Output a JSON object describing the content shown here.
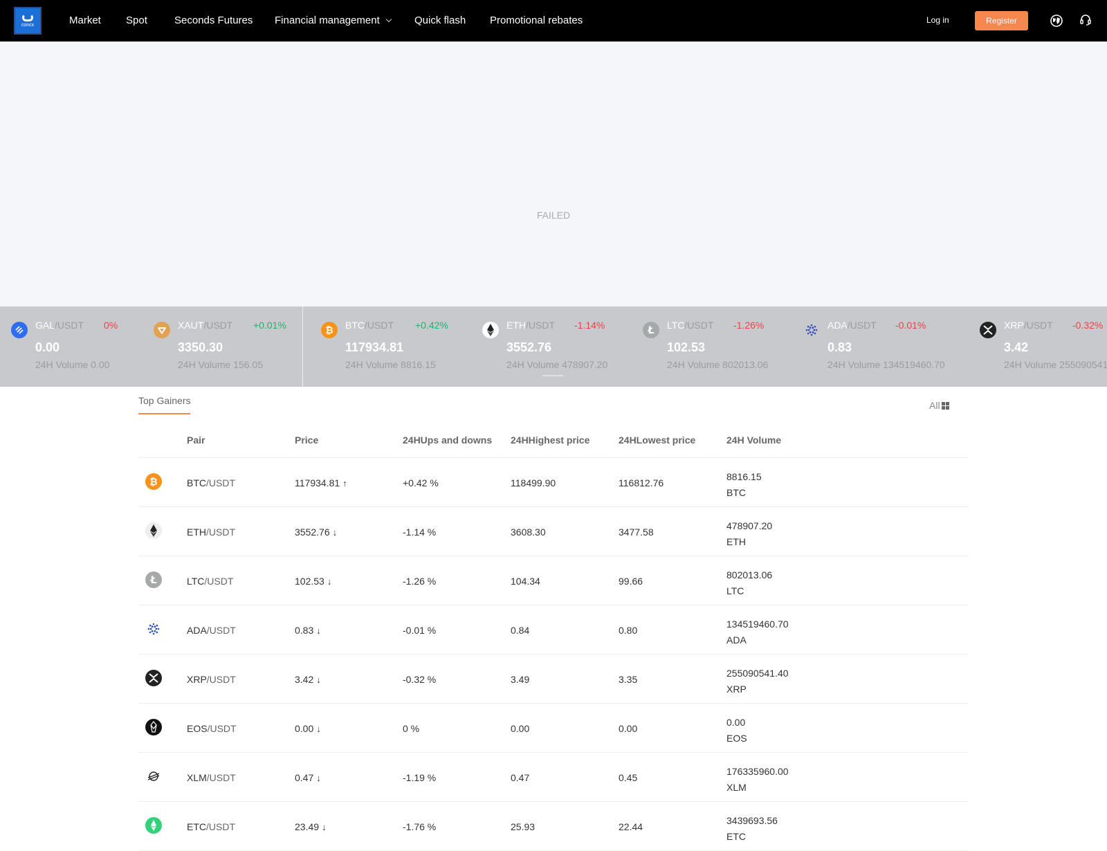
{
  "nav": {
    "logo_text": "concx",
    "items": [
      "Market",
      "Spot",
      "Seconds Futures",
      "Financial management",
      "Quick flash",
      "Promotional rebates"
    ],
    "login": "Log in",
    "register": "Register"
  },
  "banner": {
    "status": "FAILED"
  },
  "ticker": [
    {
      "base": "GAL",
      "quote": "/USDT",
      "change": "0%",
      "dir": "down",
      "price": "0.00",
      "volume": "24H Volume 0.00",
      "icon": "gal-icon",
      "color": "#2f6df0"
    },
    {
      "base": "XAUT",
      "quote": "/USDT",
      "change": "+0.01%",
      "dir": "up",
      "price": "3350.30",
      "volume": "24H Volume 156.05",
      "icon": "xaut-icon",
      "color": "#e2a252"
    },
    {
      "base": "BTC",
      "quote": "/USDT",
      "change": "+0.42%",
      "dir": "up",
      "price": "117934.81",
      "volume": "24H Volume 8816.15",
      "icon": "btc-icon",
      "color": "#f7931a"
    },
    {
      "base": "ETH",
      "quote": "/USDT",
      "change": "-1.14%",
      "dir": "down",
      "price": "3552.76",
      "volume": "24H Volume 478907.20",
      "icon": "eth-icon",
      "color": "#ffffff"
    },
    {
      "base": "LTC",
      "quote": "/USDT",
      "change": "-1.26%",
      "dir": "down",
      "price": "102.53",
      "volume": "24H Volume 802013.06",
      "icon": "ltc-icon",
      "color": "#a6a9aa"
    },
    {
      "base": "ADA",
      "quote": "/USDT",
      "change": "-0.01%",
      "dir": "down",
      "price": "0.83",
      "volume": "24H Volume 134519460.70",
      "icon": "ada-icon",
      "color": "#c7c9cd"
    },
    {
      "base": "XRP",
      "quote": "/USDT",
      "change": "-0.32%",
      "dir": "down",
      "price": "3.42",
      "volume": "24H Volume 255090541",
      "icon": "xrp-icon",
      "color": "#222222"
    }
  ],
  "market": {
    "tab": "Top Gainers",
    "all_label": "All",
    "columns": [
      "Pair",
      "Price",
      "24HUps and downs",
      "24HHighest price",
      "24HLowest price",
      "24H Volume"
    ],
    "rows": [
      {
        "base": "BTC",
        "quote": "/USDT",
        "price": "117934.81",
        "dir": "up",
        "arrow": "↑",
        "change": "+0.42 %",
        "high": "118499.90",
        "low": "116812.76",
        "volume": "8816.15",
        "unit": "BTC",
        "icon": "btc-icon",
        "color": "#f7931a"
      },
      {
        "base": "ETH",
        "quote": "/USDT",
        "price": "3552.76",
        "dir": "down",
        "arrow": "↓",
        "change": "-1.14 %",
        "high": "3608.30",
        "low": "3477.58",
        "volume": "478907.20",
        "unit": "ETH",
        "icon": "eth-icon",
        "color": "#eeeeee"
      },
      {
        "base": "LTC",
        "quote": "/USDT",
        "price": "102.53",
        "dir": "down",
        "arrow": "↓",
        "change": "-1.26 %",
        "high": "104.34",
        "low": "99.66",
        "volume": "802013.06",
        "unit": "LTC",
        "icon": "ltc-icon",
        "color": "#a6a9aa"
      },
      {
        "base": "ADA",
        "quote": "/USDT",
        "price": "0.83",
        "dir": "down",
        "arrow": "↓",
        "change": "-0.01 %",
        "high": "0.84",
        "low": "0.80",
        "volume": "134519460.70",
        "unit": "ADA",
        "icon": "ada-icon",
        "color": "#ffffff"
      },
      {
        "base": "XRP",
        "quote": "/USDT",
        "price": "3.42",
        "dir": "down",
        "arrow": "↓",
        "change": "-0.32 %",
        "high": "3.49",
        "low": "3.35",
        "volume": "255090541.40",
        "unit": "XRP",
        "icon": "xrp-icon",
        "color": "#222222"
      },
      {
        "base": "EOS",
        "quote": "/USDT",
        "price": "0.00",
        "dir": "down",
        "arrow": "↓",
        "change": "0 %",
        "high": "0.00",
        "low": "0.00",
        "volume": "0.00",
        "unit": "EOS",
        "icon": "eos-icon",
        "color": "#111111"
      },
      {
        "base": "XLM",
        "quote": "/USDT",
        "price": "0.47",
        "dir": "down",
        "arrow": "↓",
        "change": "-1.19 %",
        "high": "0.47",
        "low": "0.45",
        "volume": "176335960.00",
        "unit": "XLM",
        "icon": "xlm-icon",
        "color": "#ffffff"
      },
      {
        "base": "ETC",
        "quote": "/USDT",
        "price": "23.49",
        "dir": "down",
        "arrow": "↓",
        "change": "-1.76 %",
        "high": "25.93",
        "low": "22.44",
        "volume": "3439693.56",
        "unit": "ETC",
        "icon": "etc-icon",
        "color": "#33d17a"
      }
    ]
  }
}
